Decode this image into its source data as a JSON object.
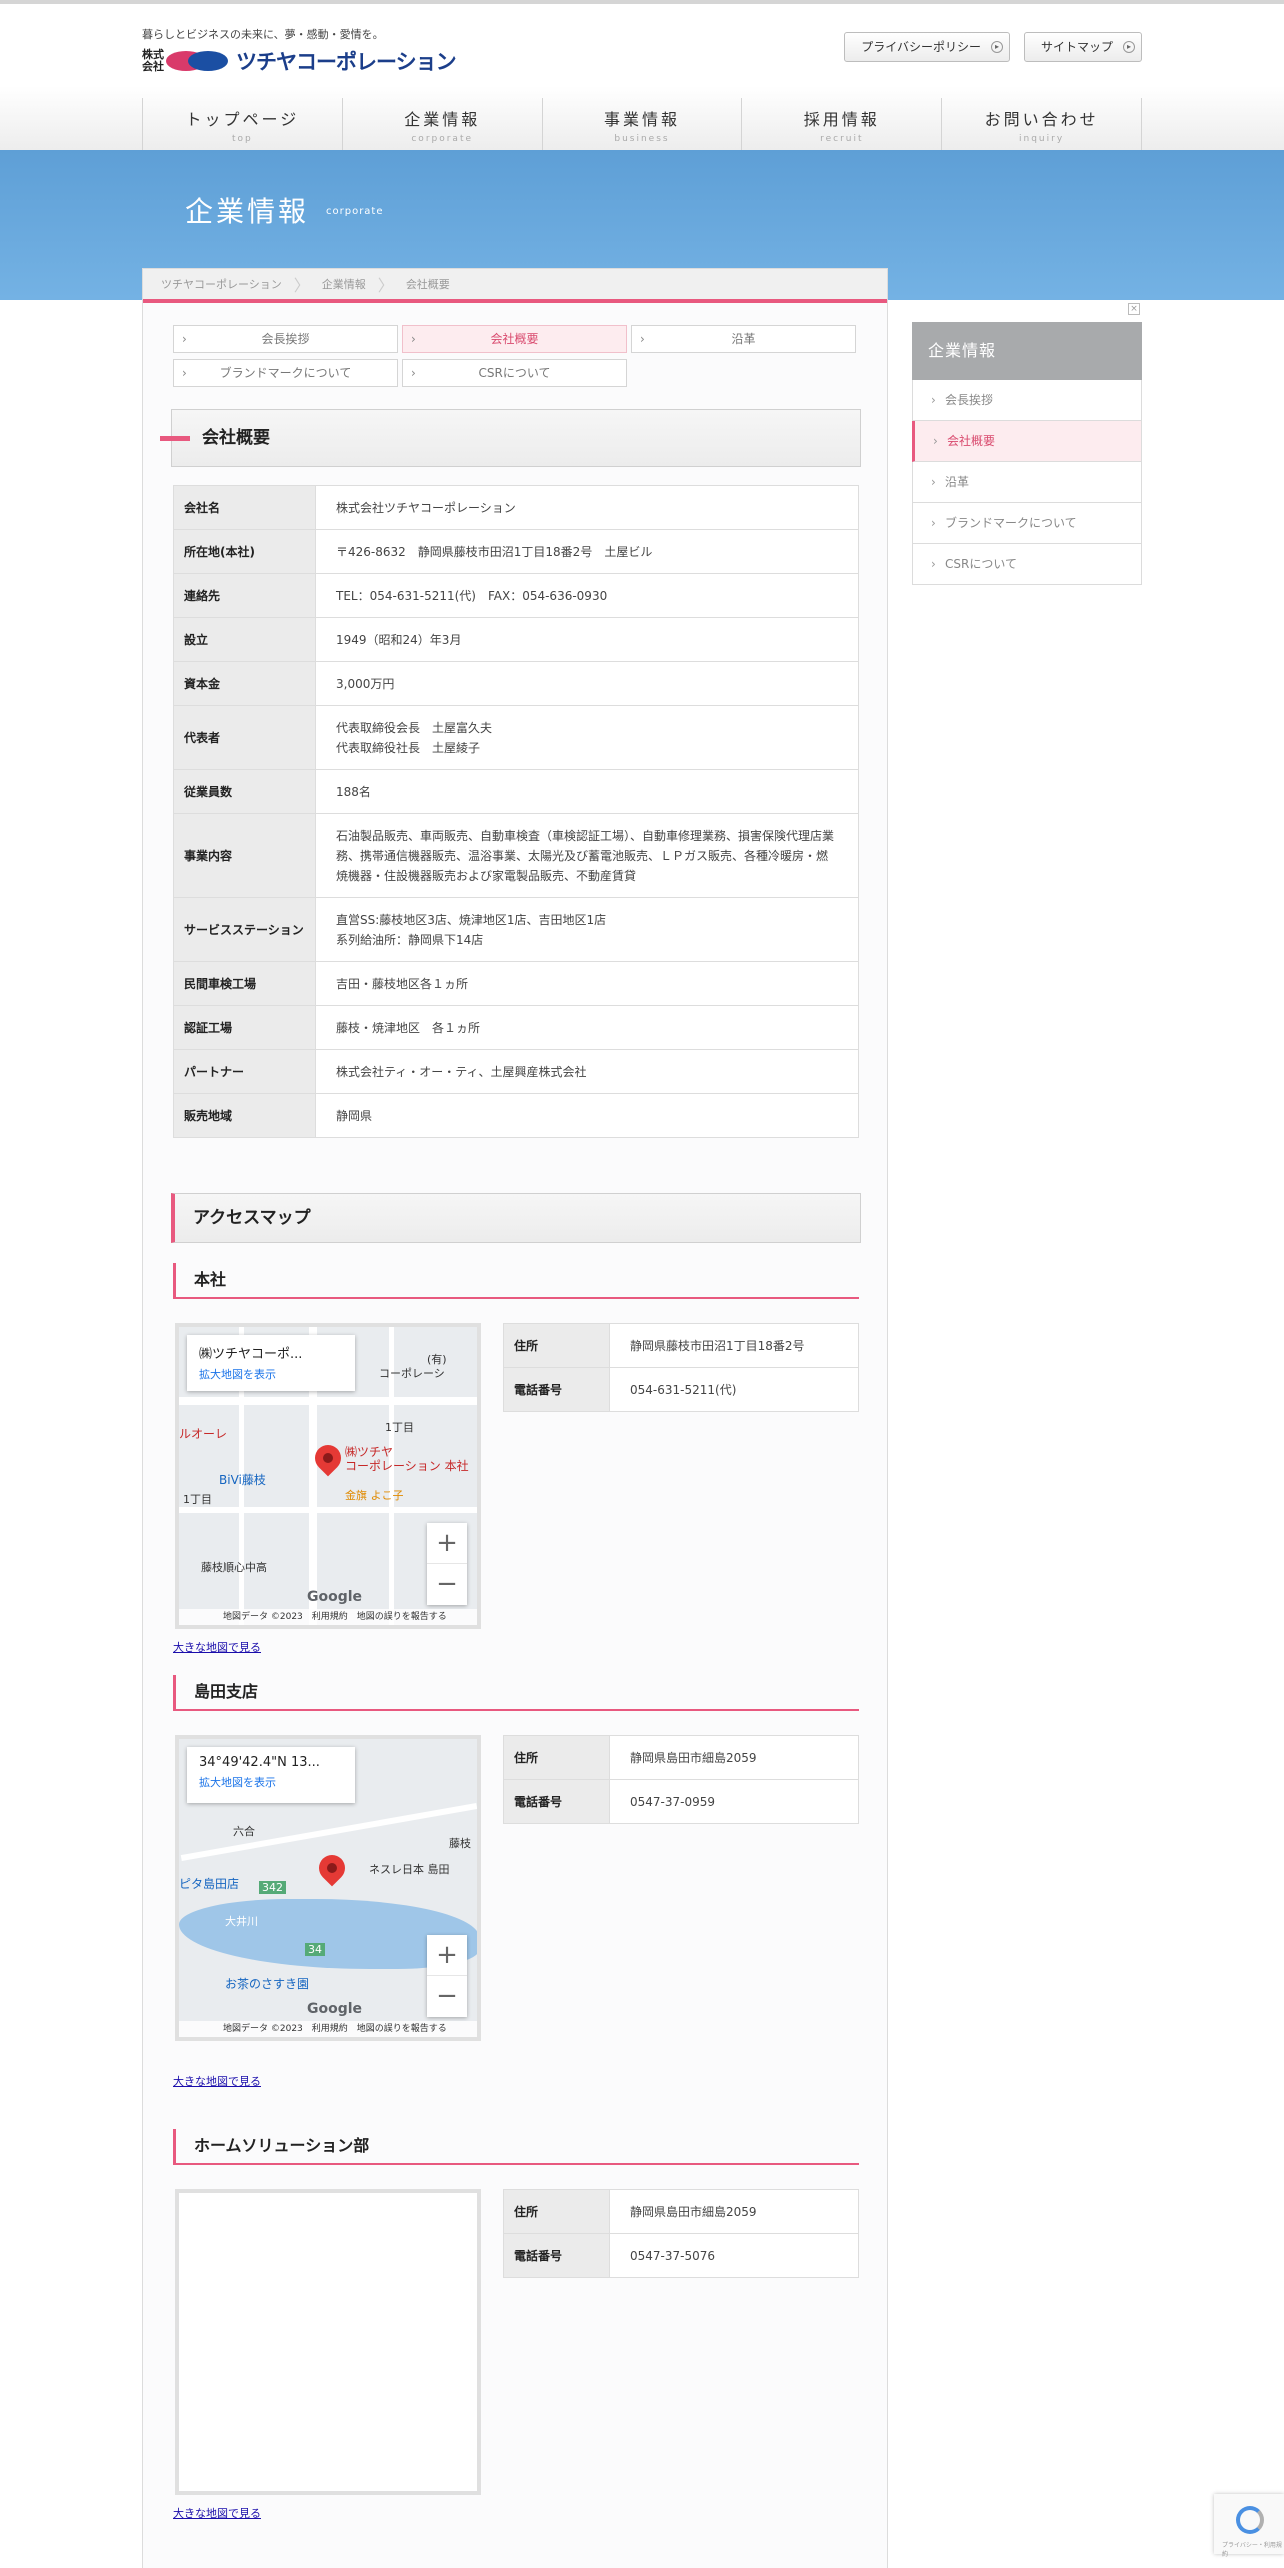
{
  "header": {
    "tagline": "暮らしとビジネスの未来に、夢・感動・愛情を。",
    "logo_kaisha": "株式会社",
    "logo_name": "ツチヤコーポレーション",
    "privacy_label": "プライバシーポリシー",
    "sitemap_label": "サイトマップ"
  },
  "gnav": [
    {
      "jp": "トップページ",
      "en": "top"
    },
    {
      "jp": "企業情報",
      "en": "corporate"
    },
    {
      "jp": "事業情報",
      "en": "business"
    },
    {
      "jp": "採用情報",
      "en": "recruit"
    },
    {
      "jp": "お問い合わせ",
      "en": "inquiry"
    }
  ],
  "hero": {
    "title": "企業情報",
    "en": "corporate"
  },
  "breadcrumb": [
    "ツチヤコーポレーション",
    "企業情報",
    "会社概要"
  ],
  "subtabs": [
    "会長挨拶",
    "会社概要",
    "沿革",
    "ブランドマークについて",
    "CSRについて"
  ],
  "section_title": "会社概要",
  "company_table": [
    {
      "label": "会社名",
      "value": "株式会社ツチヤコーポレーション"
    },
    {
      "label": "所在地(本社)",
      "value": "〒426-8632　静岡県藤枝市田沼1丁目18番2号　土屋ビル"
    },
    {
      "label": "連絡先",
      "value": "TEL：054-631-5211(代)　FAX：054-636-0930"
    },
    {
      "label": "設立",
      "value": "1949（昭和24）年3月"
    },
    {
      "label": "資本金",
      "value": "3,000万円"
    },
    {
      "label": "代表者",
      "value": "代表取締役会長　土屋富久夫\n代表取締役社長　土屋綾子"
    },
    {
      "label": "従業員数",
      "value": "188名"
    },
    {
      "label": "事業内容",
      "value": "石油製品販売、車両販売、自動車検査（車検認証工場）、自動車修理業務、損害保険代理店業務、携帯通信機器販売、温浴事業、太陽光及び蓄電池販売、ＬＰガス販売、各種冷暖房・燃焼機器・住設機器販売および家電製品販売、不動産賃貸"
    },
    {
      "label": "サービスステーション",
      "value": "直営SS:藤枝地区3店、焼津地区1店、吉田地区1店\n系列給油所：静岡県下14店"
    },
    {
      "label": "民間車検工場",
      "value": "吉田・藤枝地区各１ヵ所"
    },
    {
      "label": "認証工場",
      "value": "藤枝・焼津地区　各１ヵ所"
    },
    {
      "label": "パートナー",
      "value": "株式会社ティ・オー・ティ、土屋興産株式会社"
    },
    {
      "label": "販売地域",
      "value": "静岡県"
    }
  ],
  "access_title": "アクセスマップ",
  "branches": [
    {
      "name": "本社",
      "address_label": "住所",
      "address": "静岡県藤枝市田沼1丁目18番2号",
      "phone_label": "電話番号",
      "phone": "054-631-5211(代)",
      "map_card_title": "㈱ツチヤコーポ...",
      "map_card_link": "拡大地図を表示",
      "map_pin_label": "㈱ツチヤ\nコーポレーション 本社",
      "map_labels": [
        "(有)",
        "コーポレーシ",
        "1丁目",
        "ルオーレ",
        "BiVi藤枝",
        "1丁目",
        "金旗 よこ子",
        "藤枝順心中高"
      ],
      "big_map_link": "大きな地図で見る"
    },
    {
      "name": "島田支店",
      "address_label": "住所",
      "address": "静岡県島田市細島2059",
      "phone_label": "電話番号",
      "phone": "0547-37-0959",
      "map_card_title": "34°49'42.4\"N 13...",
      "map_card_link": "拡大地図を表示",
      "map_labels": [
        "六合",
        "ネスレ日本 島田",
        "藤枝",
        "ピタ島田店",
        "大井川",
        "お茶のさすき園",
        "342",
        "34"
      ],
      "big_map_link": "大きな地図で見る"
    },
    {
      "name": "ホームソリューション部",
      "address_label": "住所",
      "address": "静岡県島田市細島2059",
      "phone_label": "電話番号",
      "phone": "0547-37-5076",
      "big_map_link": "大きな地図で見る"
    }
  ],
  "map_footer": "地図データ ©2023　利用規約　地図の誤りを報告する",
  "map_google": "Google",
  "sidebar": {
    "title": "企業情報",
    "items": [
      "会長挨拶",
      "会社概要",
      "沿革",
      "ブランドマークについて",
      "CSRについて"
    ]
  },
  "colors": {
    "accent": "#e8597f",
    "hero": "#6aa9de",
    "text": "#333333"
  }
}
